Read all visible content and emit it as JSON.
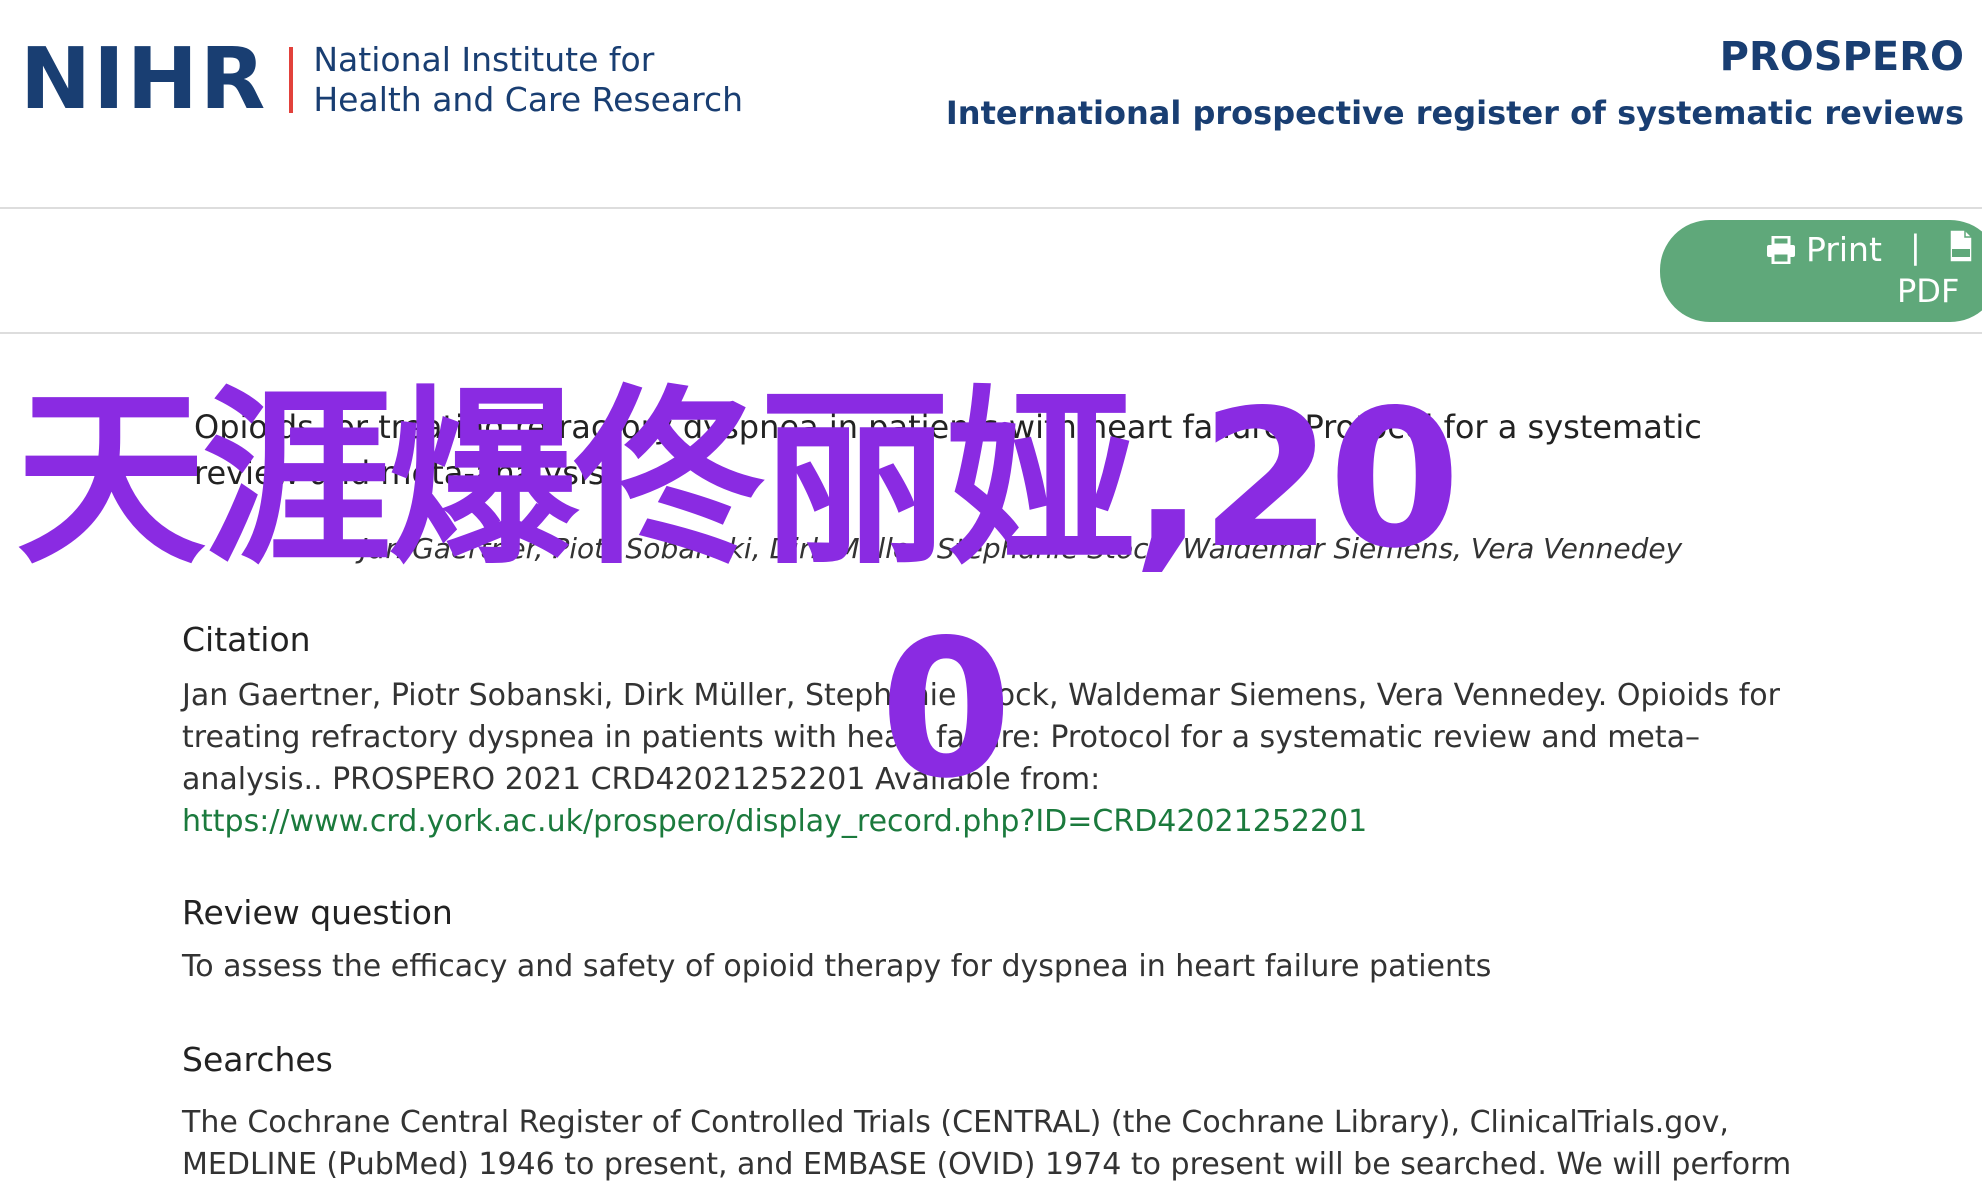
{
  "header": {
    "logo_acronym": "NIHR",
    "logo_line1": "National Institute for",
    "logo_line2": "Health and Care Research",
    "site_title": "PROSPERO",
    "site_subtitle": "International prospective register of systematic reviews"
  },
  "toolbar": {
    "print_label": "Print",
    "separator": "|",
    "pdf_label": "PDF",
    "icons": [
      "printer-icon",
      "pdf-file-icon"
    ]
  },
  "record": {
    "title": "Opioids for treating refractory dyspnea in patients with heart failure: Protocol for a systematic review and meta-analysis.",
    "authors": "Jan Gaertner, Piotr Sobanski, Dirk Müller, Stephanie Stock, Waldemar Siemens, Vera Vennedey"
  },
  "sections": {
    "citation": {
      "heading": "Citation",
      "text": "Jan Gaertner, Piotr Sobanski, Dirk Müller, Stephanie Stock, Waldemar Siemens, Vera Vennedey. Opioids for treating refractory dyspnea in patients with heart failure: Protocol for a systematic review and meta–analysis.. PROSPERO 2021 CRD42021252201 Available from:",
      "link": "https://www.crd.york.ac.uk/prospero/display_record.php?ID=CRD42021252201"
    },
    "review_question": {
      "heading": "Review question",
      "text": "To assess the efficacy and safety of opioid therapy for dyspnea in heart failure patients"
    },
    "searches": {
      "heading": "Searches",
      "text": "The Cochrane Central Register of Controlled Trials (CENTRAL) (the Cochrane Library), ClinicalTrials.gov, MEDLINE (PubMed) 1946 to present, and EMBASE (OVID) 1974 to present will be searched. We will perform"
    }
  },
  "overlay": {
    "line1": "天涯爆佟丽娅,20",
    "line2": "0"
  },
  "colors": {
    "brand_navy": "#193e72",
    "brand_red": "#e2413b",
    "button_green": "#5fa87a",
    "link_green": "#1b7a3d",
    "overlay_purple": "#8a2be2"
  }
}
